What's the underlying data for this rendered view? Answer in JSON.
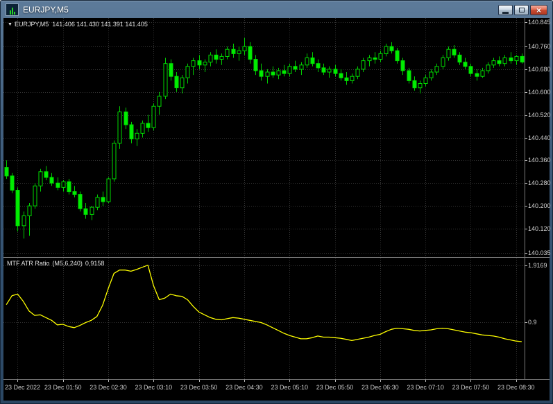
{
  "window": {
    "title": "EURJPY,M5",
    "close_glyph": "×"
  },
  "chart": {
    "arrow_glyph": "▼",
    "symbol_label": "EURJPY,M5",
    "ohlc_values": "141.406 141.430 141.391 141.405",
    "grid_color": "#353535",
    "background": "#000000",
    "text_color": "#d4d4d4"
  },
  "indicator": {
    "name": "MTF ATR Ratio",
    "params": "(M5,6,240)",
    "value": "0,9158"
  },
  "time_axis": [
    {
      "bar": 2,
      "label": "23 Dec 2022"
    },
    {
      "bar": 10,
      "label": "23 Dec 01:50"
    },
    {
      "bar": 18,
      "label": "23 Dec 02:30"
    },
    {
      "bar": 26,
      "label": "23 Dec 03:10"
    },
    {
      "bar": 34,
      "label": "23 Dec 03:50"
    },
    {
      "bar": 42,
      "label": "23 Dec 04:30"
    },
    {
      "bar": 50,
      "label": "23 Dec 05:10"
    },
    {
      "bar": 58,
      "label": "23 Dec 05:50"
    },
    {
      "bar": 66,
      "label": "23 Dec 06:30"
    },
    {
      "bar": 74,
      "label": "23 Dec 07:10"
    },
    {
      "bar": 82,
      "label": "23 Dec 07:50"
    },
    {
      "bar": 90,
      "label": "23 Dec 08:30"
    }
  ],
  "chart_data": [
    {
      "type": "candlestick",
      "title": "EURJPY M5",
      "symbol": "EURJPY",
      "timeframe": "M5",
      "ylim": [
        140.02,
        140.86
      ],
      "yticks": [
        140.845,
        140.76,
        140.68,
        140.6,
        140.52,
        140.44,
        140.36,
        140.28,
        140.2,
        140.12,
        140.035
      ],
      "grid": true,
      "wick_color": "#00cc00",
      "outline_color": "#00dd00",
      "bull_fill": "#000000",
      "bear_fill": "#00ee00",
      "columns": [
        "open",
        "high",
        "low",
        "close"
      ],
      "candles": [
        [
          140.335,
          140.36,
          140.295,
          140.305
        ],
        [
          140.305,
          140.315,
          140.245,
          140.255
        ],
        [
          140.255,
          140.265,
          140.11,
          140.13
        ],
        [
          140.13,
          140.18,
          140.085,
          140.165
        ],
        [
          140.165,
          140.21,
          140.095,
          140.2
        ],
        [
          140.2,
          140.28,
          140.19,
          140.27
        ],
        [
          140.27,
          140.33,
          140.25,
          140.32
        ],
        [
          140.32,
          140.34,
          140.29,
          140.3
        ],
        [
          140.3,
          140.315,
          140.27,
          140.28
        ],
        [
          140.28,
          140.3,
          140.255,
          140.265
        ],
        [
          140.265,
          140.29,
          140.25,
          140.285
        ],
        [
          140.285,
          140.295,
          140.24,
          140.25
        ],
        [
          140.25,
          140.27,
          140.23,
          140.24
        ],
        [
          140.24,
          140.25,
          140.18,
          140.19
        ],
        [
          140.19,
          140.21,
          140.155,
          140.17
        ],
        [
          140.17,
          140.2,
          140.15,
          140.195
        ],
        [
          140.195,
          140.24,
          140.185,
          140.23
        ],
        [
          140.23,
          140.25,
          140.2,
          140.215
        ],
        [
          140.215,
          140.3,
          140.21,
          140.295
        ],
        [
          140.295,
          140.43,
          140.285,
          140.42
        ],
        [
          140.42,
          140.55,
          140.4,
          140.53
        ],
        [
          140.53,
          140.545,
          140.47,
          140.485
        ],
        [
          140.485,
          140.495,
          140.42,
          140.435
        ],
        [
          140.435,
          140.47,
          140.41,
          140.455
        ],
        [
          140.455,
          140.5,
          140.44,
          140.49
        ],
        [
          140.49,
          140.52,
          140.46,
          140.475
        ],
        [
          140.475,
          140.56,
          140.465,
          140.55
        ],
        [
          140.55,
          140.6,
          140.52,
          140.585
        ],
        [
          140.585,
          140.72,
          140.575,
          140.7
        ],
        [
          140.7,
          140.715,
          140.64,
          140.655
        ],
        [
          140.655,
          140.67,
          140.6,
          140.615
        ],
        [
          140.615,
          140.66,
          140.595,
          140.65
        ],
        [
          140.65,
          140.7,
          140.63,
          140.69
        ],
        [
          140.69,
          140.72,
          140.66,
          140.71
        ],
        [
          140.71,
          140.73,
          140.68,
          140.695
        ],
        [
          140.695,
          140.715,
          140.67,
          140.705
        ],
        [
          140.705,
          140.74,
          140.69,
          140.73
        ],
        [
          140.73,
          140.75,
          140.7,
          140.715
        ],
        [
          140.715,
          140.735,
          140.695,
          140.725
        ],
        [
          140.725,
          140.76,
          140.715,
          140.75
        ],
        [
          140.75,
          140.77,
          140.72,
          140.735
        ],
        [
          140.735,
          140.76,
          140.71,
          140.745
        ],
        [
          140.745,
          140.79,
          140.73,
          140.76
        ],
        [
          140.76,
          140.775,
          140.7,
          140.715
        ],
        [
          140.715,
          140.73,
          140.66,
          140.675
        ],
        [
          140.675,
          140.7,
          140.64,
          140.655
        ],
        [
          140.655,
          140.68,
          140.63,
          140.67
        ],
        [
          140.67,
          140.69,
          140.65,
          140.66
        ],
        [
          140.66,
          140.685,
          140.645,
          140.675
        ],
        [
          140.675,
          140.695,
          140.655,
          140.665
        ],
        [
          140.665,
          140.7,
          140.655,
          140.69
        ],
        [
          140.69,
          140.71,
          140.67,
          140.68
        ],
        [
          140.68,
          140.705,
          140.66,
          140.695
        ],
        [
          140.695,
          140.735,
          140.685,
          140.72
        ],
        [
          140.72,
          140.74,
          140.69,
          140.7
        ],
        [
          140.7,
          140.715,
          140.67,
          140.685
        ],
        [
          140.685,
          140.7,
          140.66,
          140.67
        ],
        [
          140.67,
          140.69,
          140.65,
          140.68
        ],
        [
          140.68,
          140.695,
          140.655,
          140.665
        ],
        [
          140.665,
          140.68,
          140.64,
          140.65
        ],
        [
          140.65,
          140.67,
          140.625,
          140.64
        ],
        [
          140.64,
          140.665,
          140.63,
          140.655
        ],
        [
          140.655,
          140.69,
          140.645,
          140.68
        ],
        [
          140.68,
          140.72,
          140.67,
          140.71
        ],
        [
          140.71,
          140.73,
          140.69,
          140.72
        ],
        [
          140.72,
          140.74,
          140.7,
          140.715
        ],
        [
          140.715,
          140.745,
          140.705,
          140.735
        ],
        [
          140.735,
          140.77,
          140.725,
          140.76
        ],
        [
          140.76,
          140.775,
          140.735,
          140.745
        ],
        [
          140.745,
          140.755,
          140.7,
          140.71
        ],
        [
          140.71,
          140.72,
          140.66,
          140.675
        ],
        [
          140.675,
          140.685,
          140.63,
          140.64
        ],
        [
          140.64,
          140.655,
          140.605,
          140.615
        ],
        [
          140.615,
          140.64,
          140.595,
          140.63
        ],
        [
          140.63,
          140.66,
          140.62,
          140.65
        ],
        [
          140.65,
          140.68,
          140.64,
          140.67
        ],
        [
          140.67,
          140.7,
          140.66,
          140.69
        ],
        [
          140.69,
          140.73,
          140.68,
          140.72
        ],
        [
          140.72,
          140.76,
          140.71,
          140.75
        ],
        [
          140.75,
          140.765,
          140.72,
          140.73
        ],
        [
          140.73,
          140.74,
          140.695,
          140.705
        ],
        [
          140.705,
          140.72,
          140.68,
          140.69
        ],
        [
          140.69,
          140.7,
          140.655,
          140.665
        ],
        [
          140.665,
          140.68,
          140.64,
          140.655
        ],
        [
          140.655,
          140.685,
          140.65,
          140.675
        ],
        [
          140.675,
          140.705,
          140.665,
          140.695
        ],
        [
          140.695,
          140.72,
          140.685,
          140.71
        ],
        [
          140.71,
          140.725,
          140.69,
          140.7
        ],
        [
          140.7,
          140.73,
          140.69,
          140.72
        ],
        [
          140.72,
          140.74,
          140.7,
          140.71
        ],
        [
          140.71,
          140.73,
          140.695,
          140.725
        ],
        [
          140.725,
          140.735,
          140.7,
          140.705
        ]
      ]
    },
    {
      "type": "line",
      "title": "MTF ATR Ratio (M5,6,240)",
      "current_value": "0,9158",
      "color": "#ffff00",
      "ylim": [
        -0.12,
        2.05
      ],
      "yticks": [
        {
          "value": 1.9169,
          "label": "1.9169"
        },
        {
          "value": 0.9,
          "label": "0.9"
        }
      ],
      "values": [
        1.21,
        1.37,
        1.4,
        1.27,
        1.1,
        1.02,
        1.03,
        0.98,
        0.93,
        0.85,
        0.86,
        0.82,
        0.8,
        0.84,
        0.89,
        0.93,
        1.0,
        1.2,
        1.5,
        1.77,
        1.83,
        1.83,
        1.81,
        1.84,
        1.88,
        1.9169,
        1.55,
        1.3,
        1.33,
        1.4,
        1.37,
        1.36,
        1.3,
        1.18,
        1.08,
        1.03,
        0.98,
        0.95,
        0.94,
        0.96,
        0.98,
        0.97,
        0.95,
        0.93,
        0.91,
        0.89,
        0.85,
        0.8,
        0.75,
        0.7,
        0.66,
        0.63,
        0.6,
        0.6,
        0.62,
        0.65,
        0.63,
        0.63,
        0.62,
        0.61,
        0.59,
        0.57,
        0.59,
        0.61,
        0.63,
        0.66,
        0.68,
        0.73,
        0.77,
        0.79,
        0.78,
        0.77,
        0.75,
        0.74,
        0.75,
        0.76,
        0.78,
        0.79,
        0.78,
        0.76,
        0.74,
        0.72,
        0.71,
        0.69,
        0.67,
        0.66,
        0.65,
        0.63,
        0.6,
        0.58,
        0.56,
        0.55
      ]
    }
  ]
}
